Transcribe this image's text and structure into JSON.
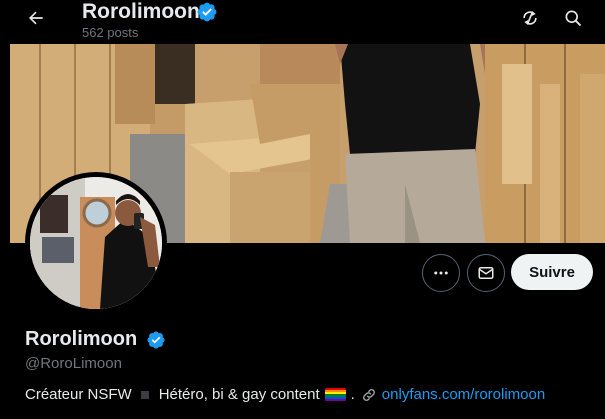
{
  "header": {
    "title": "Rorolimoon",
    "posts_count": "562 posts",
    "back_icon": "arrow-left-icon",
    "right_icons": [
      "refresh-slash-icon",
      "search-icon"
    ]
  },
  "profile": {
    "display_name": "Rorolimoon",
    "handle": "@RoroLimoon",
    "verified": true,
    "verified_color": "#1d9bf0",
    "actions": {
      "more_icon": "more-dots-icon",
      "message_icon": "envelope-icon",
      "follow_label": "Suivre"
    },
    "bio": {
      "text1": "Créateur NSFW",
      "text2": "Hétéro, bi & gay content",
      "text3": ".",
      "link_text": "onlyfans.com/rorolimoon",
      "link_color": "#1d9bf0"
    }
  },
  "colors": {
    "background": "#000000",
    "text": "#e7e9ea",
    "muted": "#71767b",
    "follow_bg": "#eff3f4"
  }
}
